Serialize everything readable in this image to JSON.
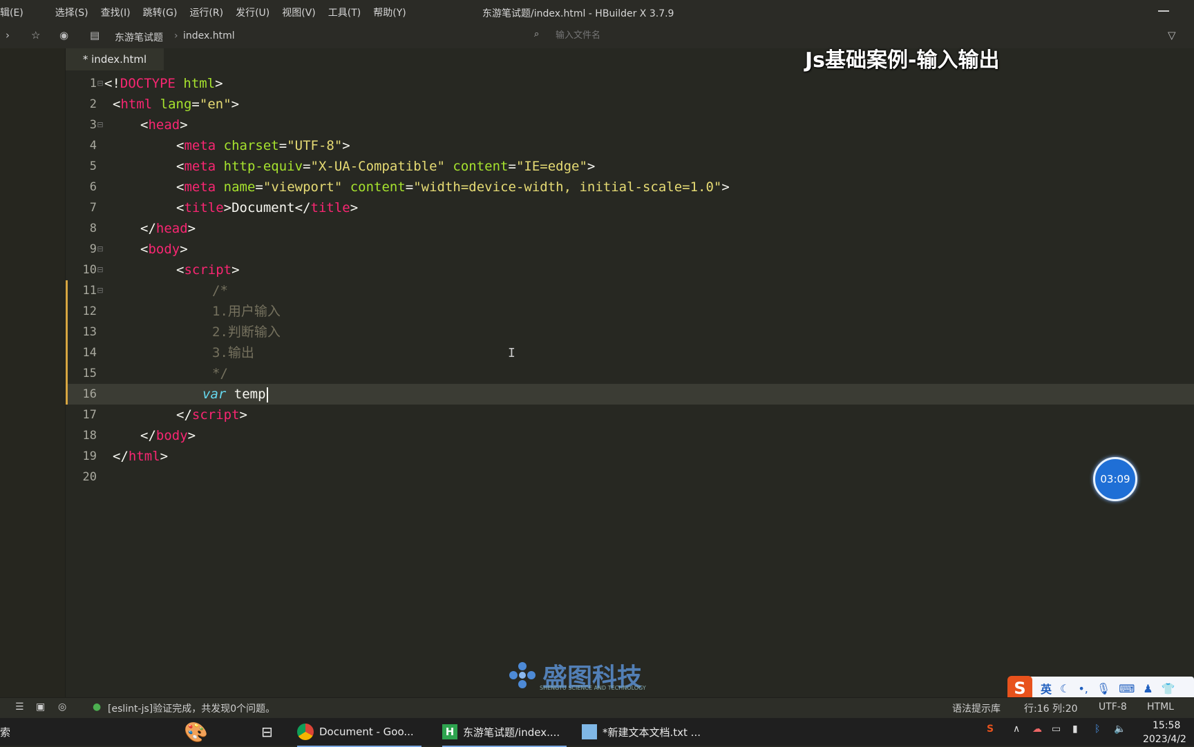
{
  "menubar": {
    "items": [
      "辑(E)",
      "选择(S)",
      "查找(I)",
      "跳转(G)",
      "运行(R)",
      "发行(U)",
      "视图(V)",
      "工具(T)",
      "帮助(Y)"
    ],
    "window_title": "东游笔试题/index.html - HBuilder X 3.7.9"
  },
  "toolbar": {
    "breadcrumb_project": "东游笔试题",
    "breadcrumb_file": "index.html",
    "file_search_placeholder": "输入文件名"
  },
  "tab": {
    "label": "* index.html"
  },
  "overlay_title": "Js基础案例-输入输出",
  "editor": {
    "lines": [
      {
        "num": "1",
        "fold": "⊟"
      },
      {
        "num": "2",
        "fold": ""
      },
      {
        "num": "3",
        "fold": "⊟"
      },
      {
        "num": "4",
        "fold": ""
      },
      {
        "num": "5",
        "fold": ""
      },
      {
        "num": "6",
        "fold": ""
      },
      {
        "num": "7",
        "fold": ""
      },
      {
        "num": "8",
        "fold": ""
      },
      {
        "num": "9",
        "fold": "⊟"
      },
      {
        "num": "10",
        "fold": "⊟"
      },
      {
        "num": "11",
        "fold": "⊟"
      },
      {
        "num": "12",
        "fold": ""
      },
      {
        "num": "13",
        "fold": ""
      },
      {
        "num": "14",
        "fold": ""
      },
      {
        "num": "15",
        "fold": ""
      },
      {
        "num": "16",
        "fold": ""
      },
      {
        "num": "17",
        "fold": ""
      },
      {
        "num": "18",
        "fold": ""
      },
      {
        "num": "19",
        "fold": ""
      },
      {
        "num": "20",
        "fold": ""
      }
    ],
    "code": {
      "l1_lt": "<!",
      "l1_tag": "DOCTYPE",
      "l1_attr": " html",
      "l1_gt": ">",
      "l2_lt": "<",
      "l2_tag": "html",
      "l2_attr": " lang",
      "l2_eq": "=",
      "l2_str": "\"en\"",
      "l2_gt": ">",
      "l3_lt": "<",
      "l3_tag": "head",
      "l3_gt": ">",
      "l4_lt": "<",
      "l4_tag": "meta",
      "l4_attr": " charset",
      "l4_eq": "=",
      "l4_str": "\"UTF-8\"",
      "l4_gt": ">",
      "l5_lt": "<",
      "l5_tag": "meta",
      "l5_attr1": " http-equiv",
      "l5_eq1": "=",
      "l5_str1": "\"X-UA-Compatible\"",
      "l5_attr2": " content",
      "l5_eq2": "=",
      "l5_str2": "\"IE=edge\"",
      "l5_gt": ">",
      "l6_lt": "<",
      "l6_tag": "meta",
      "l6_attr1": " name",
      "l6_eq1": "=",
      "l6_str1": "\"viewport\"",
      "l6_attr2": " content",
      "l6_eq2": "=",
      "l6_str2": "\"width=device-width, initial-scale=1.0\"",
      "l6_gt": ">",
      "l7_lt": "<",
      "l7_tag": "title",
      "l7_gt": ">",
      "l7_text": "Document",
      "l7_lt2": "</",
      "l7_tag2": "title",
      "l7_gt2": ">",
      "l8_lt": "</",
      "l8_tag": "head",
      "l8_gt": ">",
      "l9_lt": "<",
      "l9_tag": "body",
      "l9_gt": ">",
      "l10_lt": "<",
      "l10_tag": "script",
      "l10_gt": ">",
      "l11": "/*",
      "l12": "1.用户输入",
      "l13": "2.判断输入",
      "l14": "3.输出",
      "l15": "*/",
      "l16_kw": "var",
      "l16_text": " temp",
      "l17_lt": "</",
      "l17_tag": "script",
      "l17_gt": ">",
      "l18_lt": "</",
      "l18_tag": "body",
      "l18_gt": ">",
      "l19_lt": "</",
      "l19_tag": "html",
      "l19_gt": ">"
    }
  },
  "timer": "03:09",
  "watermark": {
    "name": "盛图科技",
    "sub": "SHENGTU SCIENCE AND TECHNOLOGY"
  },
  "statusbar": {
    "lint": "[eslint-js]验证完成，共发现0个问题。",
    "hint": "语法提示库",
    "position": "行:16  列:20",
    "encoding": "UTF-8",
    "language": "HTML"
  },
  "ime": {
    "logo": "S",
    "lang": "英"
  },
  "taskbar": {
    "search_fragment": "索",
    "tasks": [
      "Document - Goo...",
      "东游笔试题/index....",
      "*新建文本文档.txt ..."
    ],
    "time": "15:58",
    "date": "2023/4/2"
  },
  "colors": {
    "bg": "#272822",
    "tag": "#f92672",
    "attr": "#a6e22e",
    "string": "#e6db74",
    "comment": "#75715e",
    "keyword": "#66d9ef"
  }
}
